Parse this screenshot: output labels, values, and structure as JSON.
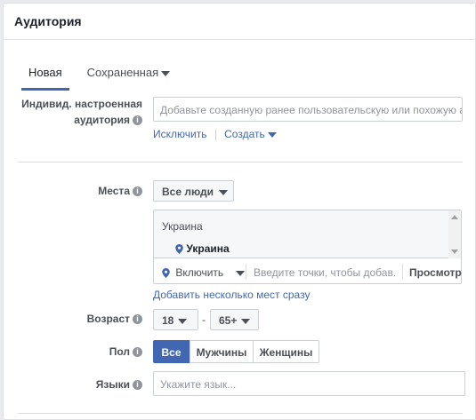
{
  "header": {
    "title": "Аудитория"
  },
  "tabs": [
    {
      "label": "Новая"
    },
    {
      "label": "Сохраненная"
    }
  ],
  "custom_audience": {
    "label_line1": "Индивид. настроенная",
    "label_line2": "аудитория",
    "placeholder": "Добавьте созданную ранее пользовательскую или похожую аудит",
    "exclude_link": "Исключить",
    "create_link": "Создать"
  },
  "locations": {
    "label": "Места",
    "dropdown_value": "Все люди",
    "group_header": "Украина",
    "items": [
      "Украина"
    ],
    "include_value": "Включить",
    "search_placeholder": "Введите точки, чтобы добав...",
    "browse_button": "Просмотр",
    "bulk_link": "Добавить несколько мест сразу"
  },
  "age": {
    "label": "Возраст",
    "min": "18",
    "separator": "-",
    "max": "65+"
  },
  "gender": {
    "label": "Пол",
    "options": [
      "Все",
      "Мужчины",
      "Женщины"
    ],
    "selected": "Все"
  },
  "languages": {
    "label": "Языки",
    "placeholder": "Укажите язык..."
  },
  "colors": {
    "accent": "#4267b2",
    "border": "#ccd0d5",
    "label_text": "#4b4f56"
  }
}
